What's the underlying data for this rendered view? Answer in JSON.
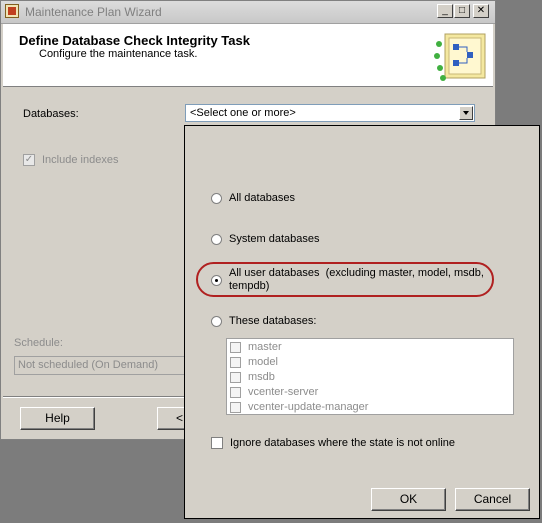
{
  "window": {
    "title": "Maintenance Plan Wizard",
    "controls": {
      "minimize": "_",
      "maximize": "□",
      "close": "✕"
    }
  },
  "header": {
    "title": "Define Database Check Integrity Task",
    "subtitle": "Configure the maintenance task."
  },
  "form": {
    "databases_label": "Databases:",
    "databases_value": "<Select one or more>",
    "include_indexes_label": "Include indexes",
    "include_indexes_checked": true,
    "schedule_label": "Schedule:",
    "schedule_value": "Not scheduled (On Demand)"
  },
  "buttons": {
    "help": "Help",
    "back_partial": "<"
  },
  "popup": {
    "options": [
      {
        "label": "All databases",
        "selected": false
      },
      {
        "label": "System databases",
        "selected": false
      },
      {
        "label": "All user databases  (excluding master, model, msdb,",
        "label2": "tempdb)",
        "selected": true
      },
      {
        "label": "These databases:",
        "selected": false
      }
    ],
    "database_list": [
      "master",
      "model",
      "msdb",
      "vcenter-server",
      "vcenter-update-manager"
    ],
    "ignore_offline_label": "Ignore databases where the state is not online",
    "ok": "OK",
    "cancel": "Cancel"
  },
  "colors": {
    "dialog_bg": "#d4d0c8",
    "highlight_oval": "#b02020",
    "disabled_text": "#8c8c8c"
  }
}
